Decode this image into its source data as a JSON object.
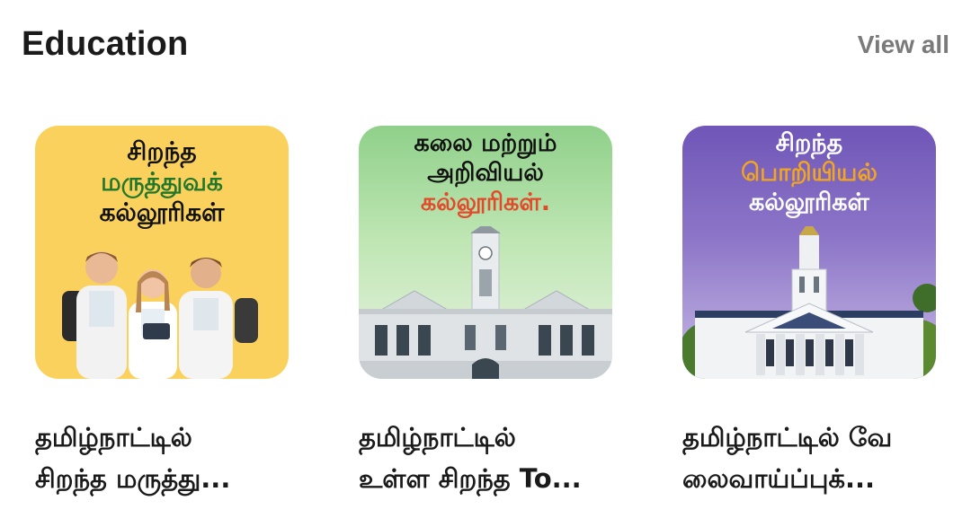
{
  "section": {
    "title": "Education",
    "view_all_label": "View all"
  },
  "cards": [
    {
      "thumb_lines": [
        "சிறந்த",
        "மருத்துவக்",
        "கல்லூரிகள்"
      ],
      "caption_lines": [
        "தமிழ்நாட்டில்",
        "சிறந்த மருத்து..."
      ],
      "colors": {
        "background": "#fbd15d",
        "accent": "#23772a"
      }
    },
    {
      "thumb_lines": [
        "கலை மற்றும்",
        "அறிவியல்",
        "கல்லூரிகள்."
      ],
      "caption_lines": [
        "தமிழ்நாட்டில்",
        "உள்ள சிறந்த To..."
      ],
      "colors": {
        "background": "#8fd08a",
        "accent": "#e24a2a"
      }
    },
    {
      "thumb_lines": [
        "சிறந்த",
        "பொறியியல்",
        "கல்லூரிகள்"
      ],
      "caption_lines": [
        "தமிழ்நாட்டில் வே",
        "லைவாய்ப்புக்..."
      ],
      "colors": {
        "background": "#6f56b8",
        "accent": "#f2a51f"
      }
    }
  ]
}
